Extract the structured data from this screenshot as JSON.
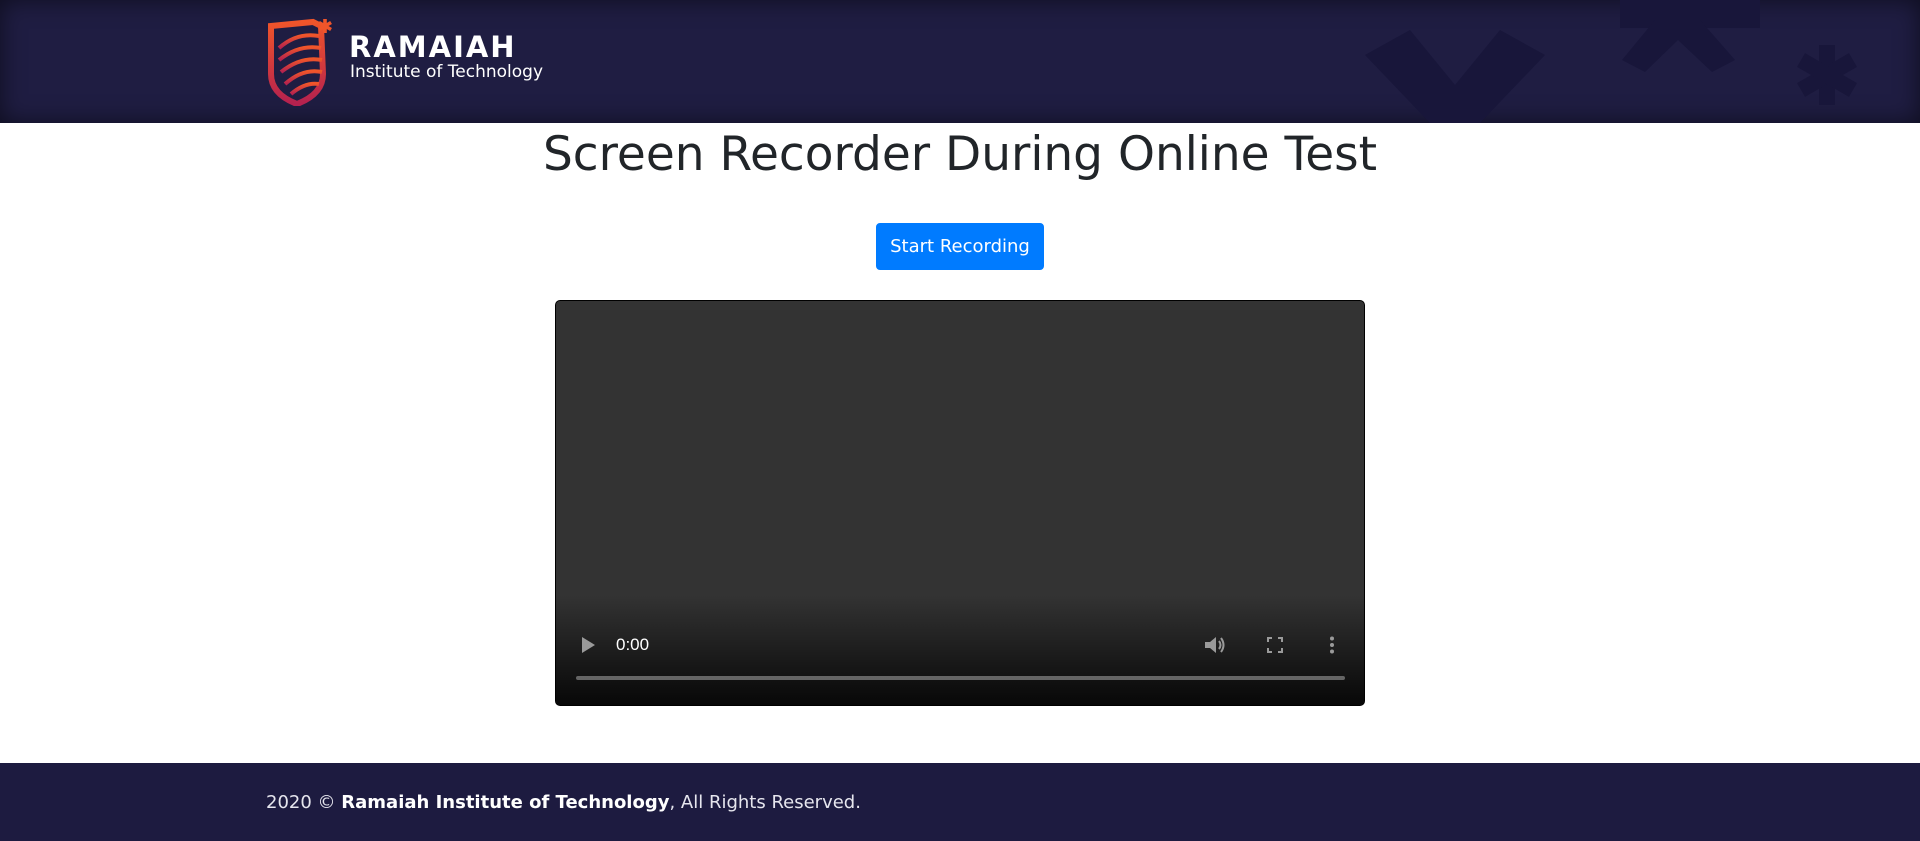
{
  "header": {
    "logo": {
      "name": "RAMAIAH",
      "subtitle": "Institute of Technology",
      "icon": "ramaiah-shield-logo"
    },
    "background_color": "#1f1d42"
  },
  "main": {
    "title": "Screen Recorder During Online Test",
    "record_button_label": "Start Recording",
    "video": {
      "current_time": "0:00",
      "progress": 0,
      "controls": [
        "play-icon",
        "volume-icon",
        "fullscreen-icon",
        "more-options-icon"
      ]
    }
  },
  "footer": {
    "year": "2020",
    "copyright_symbol": "©",
    "org_name": "Ramaiah Institute of Technology",
    "rights": ", All Rights Reserved."
  },
  "colors": {
    "primary_button": "#007bff",
    "header_bg": "#1f1d42",
    "footer_bg": "#1d1b40",
    "logo_accent": "#e0452b"
  }
}
